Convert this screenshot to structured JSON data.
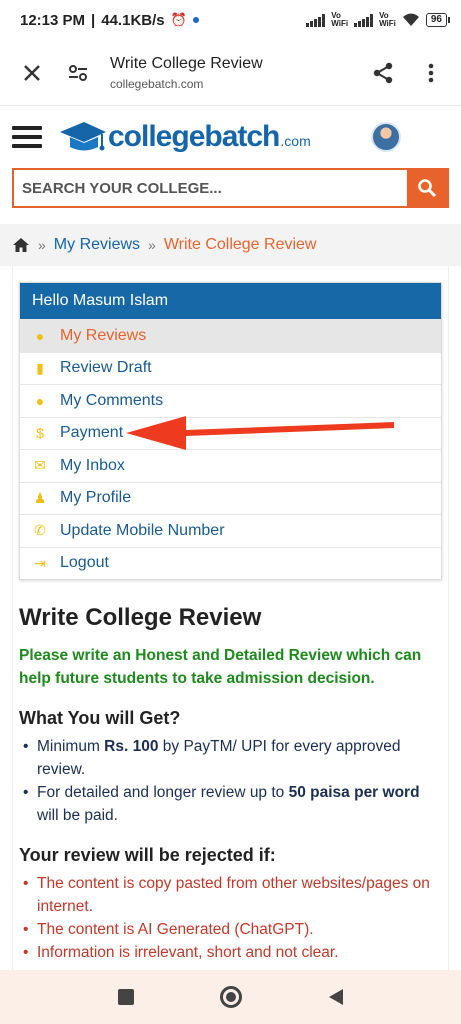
{
  "status": {
    "time": "12:13 PM",
    "speed": "44.1KB/s",
    "volte_top": "Vo",
    "volte_bottom": "WiFi",
    "battery": "96"
  },
  "browser": {
    "title": "Write College Review",
    "domain": "collegebatch.com"
  },
  "site": {
    "logo_main": "collegebatch",
    "logo_suffix": ".com"
  },
  "search": {
    "placeholder": "SEARCH YOUR COLLEGE..."
  },
  "breadcrumb": {
    "sep": "»",
    "my_reviews": "My Reviews",
    "current": "Write College Review"
  },
  "menu": {
    "greeting": "Hello Masum Islam",
    "items": [
      {
        "label": "My Reviews",
        "icon": "comment-icon"
      },
      {
        "label": "Review Draft",
        "icon": "file-icon"
      },
      {
        "label": "My Comments",
        "icon": "comment-icon"
      },
      {
        "label": "Payment",
        "icon": "dollar-icon"
      },
      {
        "label": "My Inbox",
        "icon": "envelope-icon"
      },
      {
        "label": "My Profile",
        "icon": "user-icon"
      },
      {
        "label": "Update Mobile Number",
        "icon": "phone-icon"
      },
      {
        "label": "Logout",
        "icon": "logout-icon"
      }
    ]
  },
  "content": {
    "heading": "Write College Review",
    "intro": "Please write an Honest and Detailed Review which can help future students to take admission decision.",
    "get_heading": "What You will Get?",
    "get_1_a": "Minimum ",
    "get_1_b": "Rs. 100",
    "get_1_c": " by PayTM/ UPI for every approved review.",
    "get_2_a": "For detailed and longer review up to ",
    "get_2_b": "50 paisa per word",
    "get_2_c": " will be paid.",
    "reject_heading": "Your review will be rejected if:",
    "reject": [
      "The content is copy pasted from other websites/pages on internet.",
      "The content is AI Generated (ChatGPT).",
      "Information is irrelevant, short and not clear."
    ]
  },
  "colors": {
    "brand_blue": "#1768a6",
    "accent_orange": "#e8632c",
    "intro_green": "#1e8a1e",
    "reject_red": "#c0392b",
    "annotation_arrow": "#ee3b1f"
  }
}
